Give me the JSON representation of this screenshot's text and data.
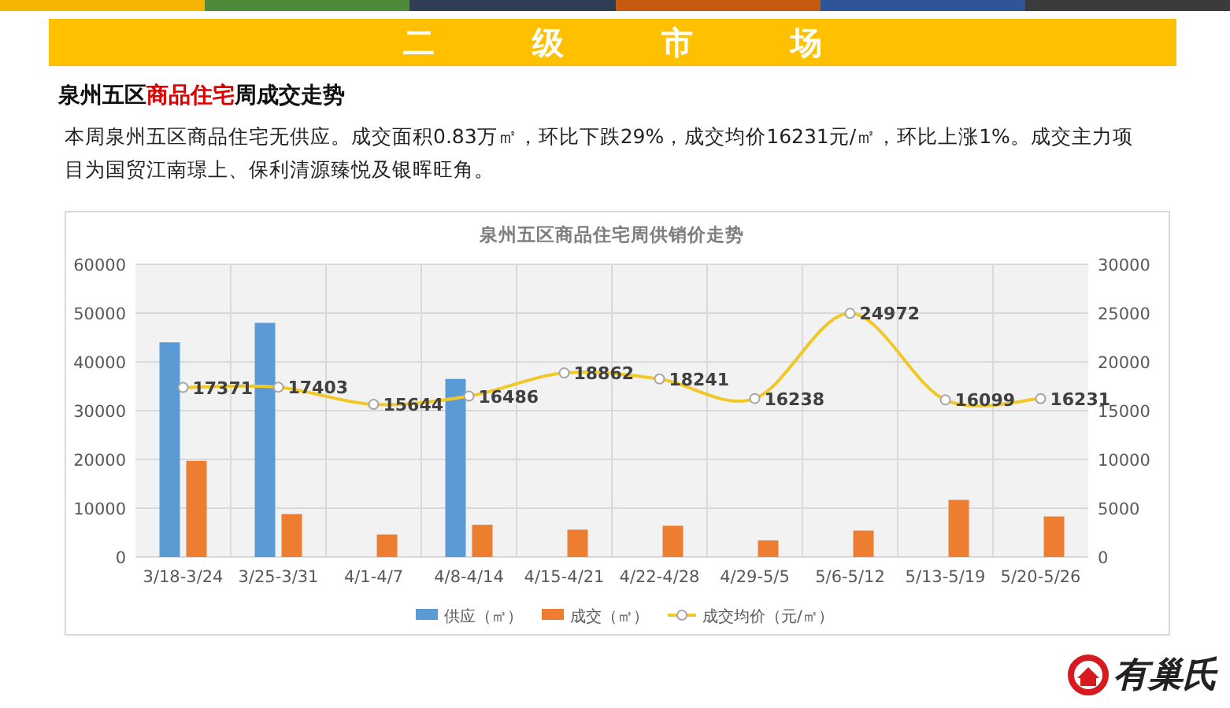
{
  "top_stripe": [
    {
      "color": "#f5b400"
    },
    {
      "color": "#4e8a3a"
    },
    {
      "color": "#2f3e55"
    },
    {
      "color": "#c55a11"
    },
    {
      "color": "#2e5597"
    },
    {
      "color": "#3b3b3b"
    }
  ],
  "banner": {
    "title": "二级市场"
  },
  "heading": {
    "parts": [
      {
        "text": "泉州五区",
        "highlight": false
      },
      {
        "text": "商品住宅",
        "highlight": true
      },
      {
        "text": "周成交走势",
        "highlight": false
      }
    ]
  },
  "summary": "本周泉州五区商品住宅无供应。成交面积0.83万㎡，环比下跌29%，成交均价16231元/㎡，环比上涨1%。成交主力项目为国贸江南璟上、保利清源臻悦及银晖旺角。",
  "chart": {
    "chart_data": {
      "type": "bar",
      "title": "泉州五区商品住宅周供销价走势",
      "categories": [
        "3/18-3/24",
        "3/25-3/31",
        "4/1-4/7",
        "4/8-4/14",
        "4/15-4/21",
        "4/22-4/28",
        "4/29-5/5",
        "5/6-5/12",
        "5/13-5/19",
        "5/20-5/26"
      ],
      "series": [
        {
          "name": "供应（㎡）",
          "color": "#5b9bd5",
          "values": [
            44000,
            48000,
            null,
            36500,
            null,
            null,
            null,
            null,
            null,
            null
          ]
        },
        {
          "name": "成交（㎡）",
          "color": "#ed7d31",
          "values": [
            19700,
            8800,
            4600,
            6600,
            5600,
            6400,
            3400,
            5400,
            11700,
            8300
          ]
        },
        {
          "name": "成交均价（元/㎡）",
          "type": "line",
          "axis": "y2",
          "marker": "circle",
          "color": "#f0c929",
          "values": [
            17371,
            17403,
            15644,
            16486,
            18862,
            18241,
            16238,
            24972,
            16099,
            16231
          ],
          "value_labels": [
            "17371",
            "17403",
            "15644",
            "16486",
            "18862",
            "18241",
            "16238",
            "24972",
            "16099",
            "16231"
          ]
        }
      ],
      "ylim": [
        0,
        60000
      ],
      "yticks": [
        0,
        10000,
        20000,
        30000,
        40000,
        50000,
        60000
      ],
      "y2lim": [
        0,
        30000
      ],
      "y2ticks": [
        0,
        5000,
        10000,
        15000,
        20000,
        25000,
        30000
      ],
      "grid": true,
      "legend": "bottom"
    }
  },
  "logo": {
    "text": "有巢氏"
  }
}
